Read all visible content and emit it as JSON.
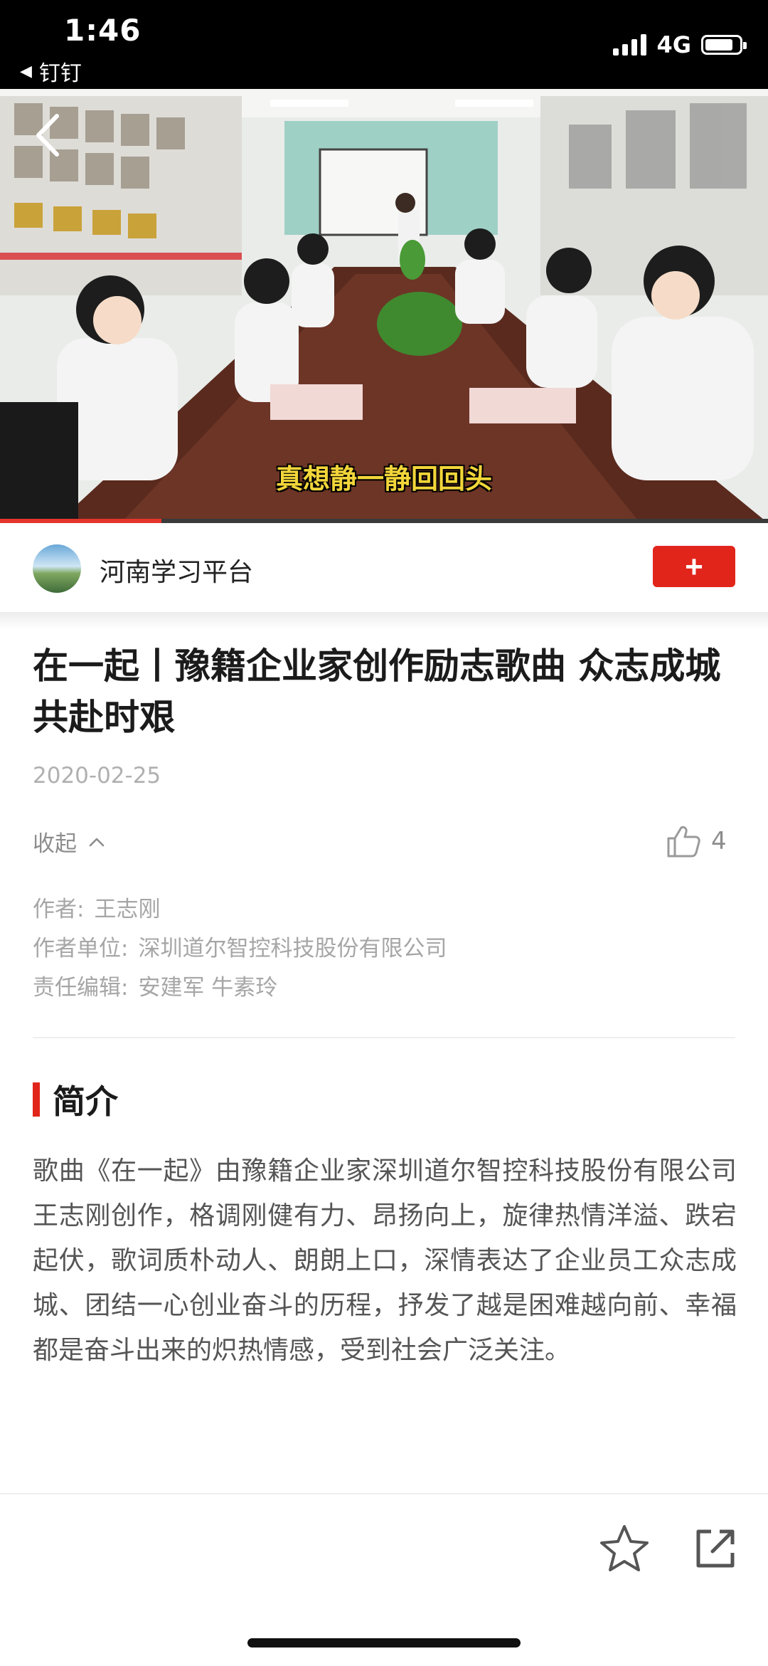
{
  "status_bar": {
    "time": "1:46",
    "back_app": "钉钉",
    "network": "4G"
  },
  "video": {
    "subtitle": "真想静一静回回头",
    "progress": 0.21
  },
  "source": {
    "name": "河南学习平台",
    "follow_label": "+"
  },
  "article": {
    "title": "在一起丨豫籍企业家创作励志歌曲 众志成城 共赴时艰",
    "date": "2020-02-25",
    "collapse_label": "收起",
    "likes": "4",
    "meta": [
      {
        "label": "作者:",
        "value": "王志刚"
      },
      {
        "label": "作者单位:",
        "value": "深圳道尔智控科技股份有限公司"
      },
      {
        "label": "责任编辑:",
        "value": "安建军 牛素玲"
      }
    ],
    "section_title": "简介",
    "body": "歌曲《在一起》由豫籍企业家深圳道尔智控科技股份有限公司王志刚创作，格调刚健有力、昂扬向上，旋律热情洋溢、跌宕起伏，歌词质朴动人、朗朗上口，深情表达了企业员工众志成城、团结一心创业奋斗的历程，抒发了越是困难越向前、幸福都是奋斗出来的炽热情感，受到社会广泛关注。"
  },
  "icons": {
    "back": "chevron-left-icon",
    "like": "thumbs-up-icon",
    "favorite": "star-icon",
    "share": "share-icon"
  },
  "colors": {
    "accent": "#e1251b",
    "subtitle": "#f2d63a"
  }
}
